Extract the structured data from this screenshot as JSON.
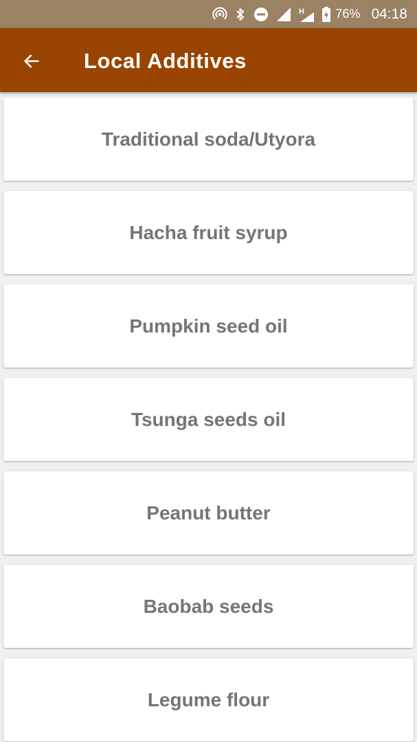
{
  "status_bar": {
    "battery_percent": "76%",
    "time": "04:18",
    "network_type": "H",
    "icons": [
      "hotspot-icon",
      "bluetooth-icon",
      "do-not-disturb-icon",
      "signal-icon",
      "signal-h-icon",
      "battery-charging-icon"
    ]
  },
  "app_bar": {
    "title": "Local Additives",
    "back_icon": "back-arrow-icon",
    "color": "#994400"
  },
  "items": [
    {
      "label": "Traditional soda/Utyora"
    },
    {
      "label": "Hacha fruit syrup"
    },
    {
      "label": "Pumpkin seed oil"
    },
    {
      "label": "Tsunga seeds oil"
    },
    {
      "label": "Peanut butter"
    },
    {
      "label": "Baobab seeds"
    },
    {
      "label": "Legume flour"
    }
  ]
}
